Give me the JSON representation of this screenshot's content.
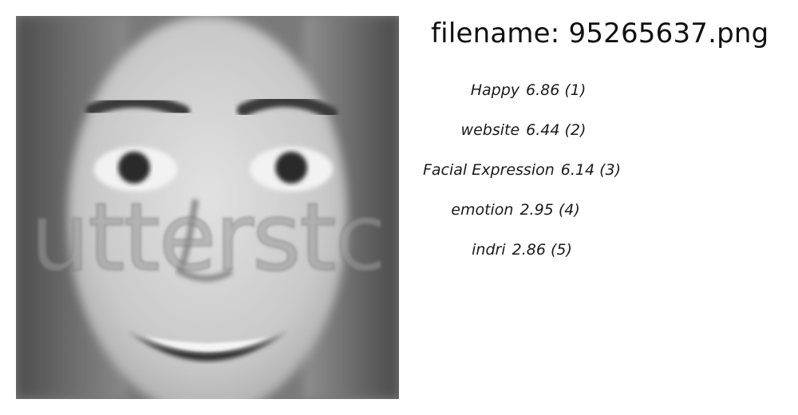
{
  "header": {
    "filename_prefix": "filename:",
    "filename_value": "95265637.png"
  },
  "predictions": [
    {
      "label": "Happy",
      "score": "6.86",
      "rank": "(1)"
    },
    {
      "label": "website",
      "score": "6.44",
      "rank": "(2)"
    },
    {
      "label": "Facial Expression",
      "score": "6.14",
      "rank": "(3)"
    },
    {
      "label": "emotion",
      "score": "2.95",
      "rank": "(4)"
    },
    {
      "label": "indri",
      "score": "2.86",
      "rank": "(5)"
    }
  ],
  "image": {
    "watermark_text": "utterstc",
    "tone": "grayscale"
  }
}
